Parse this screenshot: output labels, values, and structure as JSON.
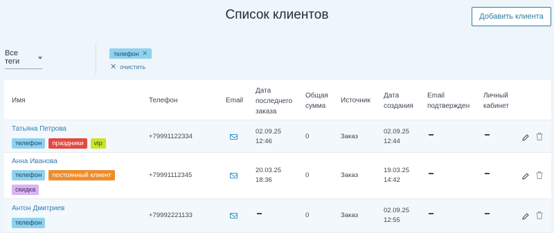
{
  "header": {
    "title": "Список клиентов",
    "add_button": "Добавить клиента"
  },
  "filters": {
    "tags_select": "Все теги",
    "active_chip": "телефон",
    "clear_label": "очистить"
  },
  "table": {
    "headers": {
      "name": "Имя",
      "phone": "Телефон",
      "email": "Email",
      "last_order": [
        "Дата",
        "последнего",
        "заказа"
      ],
      "total": [
        "Общая",
        "сумма"
      ],
      "source": "Источник",
      "created": [
        "Дата",
        "создания"
      ],
      "email_confirmed": [
        "Email",
        "подтвержден"
      ],
      "cabinet": [
        "Личный",
        "кабинет"
      ]
    },
    "rows": [
      {
        "name": "Татьяна Петрова",
        "tags": [
          {
            "label": "телефон",
            "color": "#8fd2ef"
          },
          {
            "label": "праздники",
            "color": "#e34a42"
          },
          {
            "label": "vip",
            "color": "#c9e32c"
          }
        ],
        "phone": "+79991122334",
        "last_order_date": "02.09.25",
        "last_order_time": "12:46",
        "total": "0",
        "source": "Заказ",
        "created_date": "02.09.25",
        "created_time": "12:44"
      },
      {
        "name": "Анна Иванова",
        "tags": [
          {
            "label": "телефон",
            "color": "#8fd2ef"
          },
          {
            "label": "постоянный клиент",
            "color": "#ef8c2c"
          },
          {
            "label": "скидка",
            "color": "#d9b4f0"
          }
        ],
        "phone": "+79991112345",
        "last_order_date": "20.03.25",
        "last_order_time": "18:36",
        "total": "0",
        "source": "Заказ",
        "created_date": "19.03.25",
        "created_time": "14:42"
      },
      {
        "name": "Антон Дмитриев",
        "tags": [
          {
            "label": "телефон",
            "color": "#8fd2ef"
          }
        ],
        "phone": "+79992221133",
        "last_order_date": "",
        "last_order_time": "",
        "total": "0",
        "source": "Заказ",
        "created_date": "02.09.25",
        "created_time": "12:55"
      }
    ]
  },
  "icons": {
    "email": "mail-icon",
    "edit": "pencil-icon",
    "delete": "trash-icon",
    "dash": "em-dash"
  },
  "colors": {
    "accent": "#2a7d9c",
    "link": "#2e7fae",
    "page_bg": "#eef5fb"
  }
}
